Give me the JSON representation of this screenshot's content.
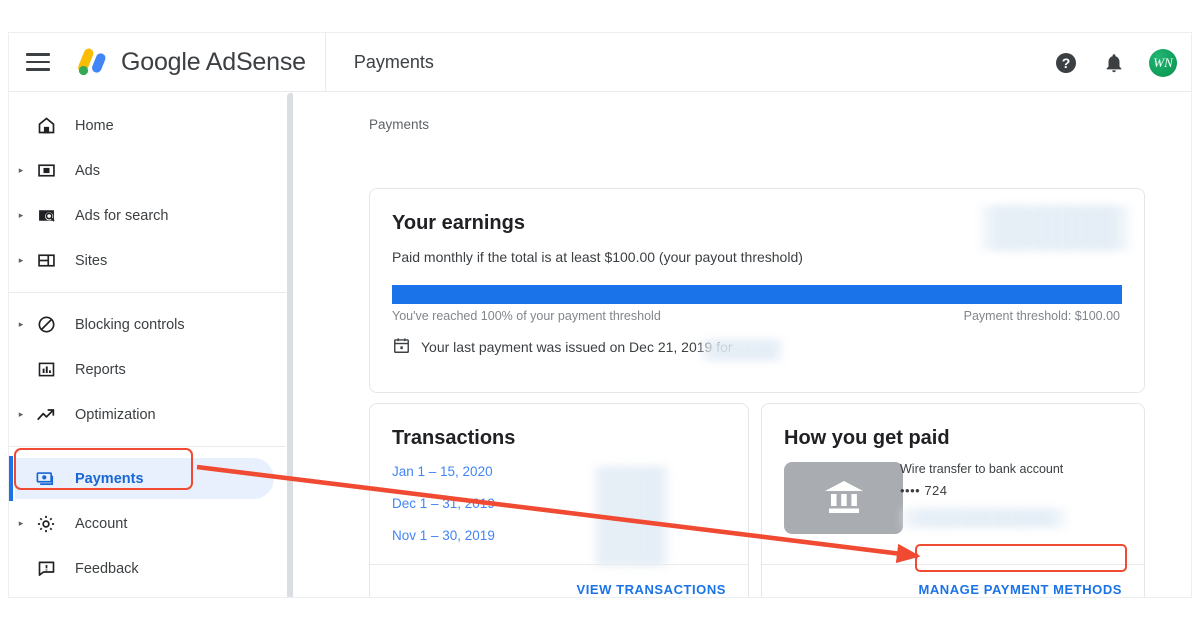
{
  "topbar": {
    "menu_icon": "hamburger-menu-icon",
    "brand_logo": "google-adsense-logo-icon",
    "brand_text": "Google AdSense",
    "page_title": "Payments",
    "help_icon": "help-circle-icon",
    "notifications_icon": "bell-icon",
    "avatar_initials": "WN"
  },
  "sidebar": {
    "items": [
      {
        "label": "Home",
        "icon": "home-icon",
        "expandable": false,
        "active": false
      },
      {
        "label": "Ads",
        "icon": "ads-rectangle-icon",
        "expandable": true,
        "active": false
      },
      {
        "label": "Ads for search",
        "icon": "ads-for-search-icon",
        "expandable": true,
        "active": false
      },
      {
        "label": "Sites",
        "icon": "sites-layout-icon",
        "expandable": true,
        "active": false
      },
      {
        "label": "Blocking controls",
        "icon": "block-circle-slash-icon",
        "expandable": true,
        "active": false
      },
      {
        "label": "Reports",
        "icon": "bar-chart-icon",
        "expandable": false,
        "active": false
      },
      {
        "label": "Optimization",
        "icon": "trending-up-arrow-icon",
        "expandable": true,
        "active": false
      },
      {
        "label": "Payments",
        "icon": "money-bills-icon",
        "expandable": false,
        "active": true
      },
      {
        "label": "Account",
        "icon": "gear-icon",
        "expandable": true,
        "active": false
      },
      {
        "label": "Feedback",
        "icon": "feedback-exclamation-icon",
        "expandable": false,
        "active": false
      }
    ]
  },
  "content": {
    "breadcrumb": "Payments",
    "earnings": {
      "title": "Your earnings",
      "subtitle": "Paid monthly if the total is at least $100.00 (your payout threshold)",
      "progress_percent": 100,
      "progress_caption_left": "You've reached 100% of your payment threshold",
      "progress_caption_right": "Payment threshold: $100.00",
      "last_payment_icon": "calendar-icon",
      "last_payment_text": "Your last payment was issued on Dec 21, 2019 for",
      "amount_redacted": true
    },
    "transactions": {
      "title": "Transactions",
      "rows": [
        "Jan 1 – 15, 2020",
        "Dec 1 – 31, 2019",
        "Nov 1 – 30, 2019"
      ],
      "footer_button": "VIEW TRANSACTIONS"
    },
    "how_you_get_paid": {
      "title": "How you get paid",
      "card_icon": "bank-building-icon",
      "method": "Wire transfer to bank account",
      "account_mask": "•••• 724",
      "footer_button": "MANAGE PAYMENT METHODS"
    }
  },
  "annotations": {
    "highlight_color": "#f04a32",
    "boxes": [
      {
        "name": "payments-nav-highlight",
        "target": "Payments"
      },
      {
        "name": "manage-payment-methods-highlight",
        "target": "MANAGE PAYMENT METHODS"
      }
    ],
    "arrow": {
      "from": "Payments",
      "to": "MANAGE PAYMENT METHODS"
    }
  },
  "colors": {
    "accent_blue": "#1a73e8",
    "link_blue": "#4285f4",
    "active_pill": "#e8f0fe",
    "annotation_red": "#f04a32",
    "bank_card_gray": "#a9adb2",
    "avatar_green": "#0f9d58"
  }
}
